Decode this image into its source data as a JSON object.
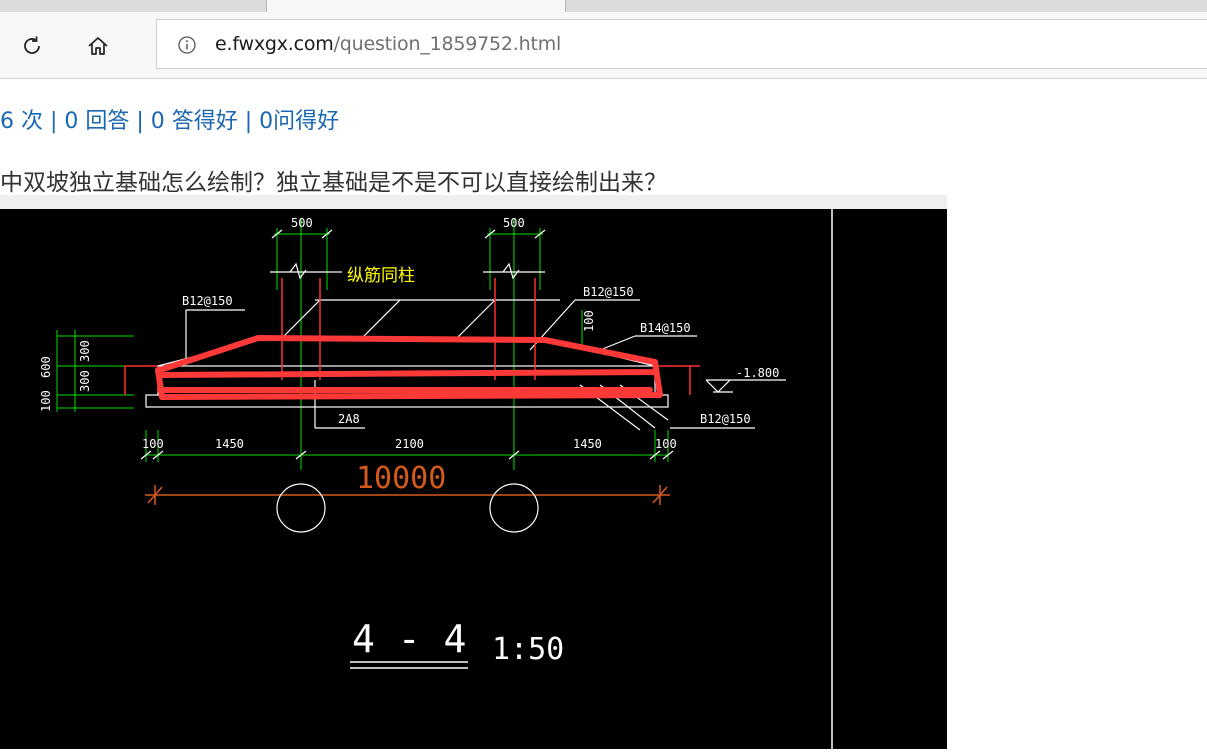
{
  "browser": {
    "url_host": "e.fwxgx.com",
    "url_path": "/question_1859752.html"
  },
  "page": {
    "stats": "6 次 | 0 回答 | 0 答得好 | 0问得好",
    "question": "中双坡独立基础怎么绘制？独立基础是不是不可以直接绘制出来？"
  },
  "drawing": {
    "labels": {
      "col_width_left": "500",
      "col_width_right": "500",
      "rebar_note": "纵筋同柱",
      "rebar_b12_left": "B12@150",
      "rebar_b12_right": "B12@150",
      "rebar_b14": "B14@150",
      "rebar_b12_bottom": "B12@150",
      "stirrup": "2A8",
      "elevation": "-1.800",
      "dim_100_height": "100",
      "dim_600": "600",
      "dim_300_top": "300",
      "dim_300_bottom": "300",
      "dim_100_base": "100",
      "dim_100_left": "100",
      "dim_1450_left": "1450",
      "dim_2100": "2100",
      "dim_1450_right": "1450",
      "dim_100_right": "100",
      "dim_total": "10000",
      "section_title": "4 - 4",
      "scale": "1:50"
    },
    "colors": {
      "background": "#000000",
      "lines": "#ffffff",
      "dimension": "#00e000",
      "column": "#ff3030",
      "highlight": "#ff3838",
      "note": "#ffff00",
      "total_dim": "#d45a1a"
    }
  }
}
